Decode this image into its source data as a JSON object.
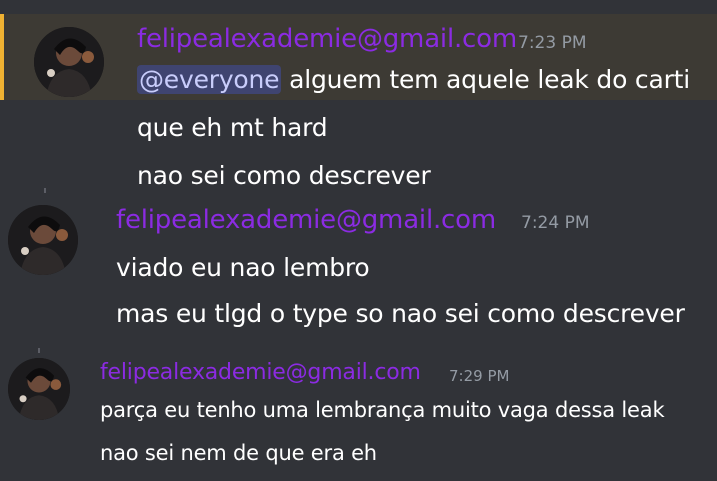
{
  "colors": {
    "background": "#313338",
    "mention_highlight": "#3d3a34",
    "mention_border": "#f0b232",
    "author": "#8b2be2",
    "timestamp": "#949ba4",
    "text": "#ffffff",
    "mention_tag_bg": "#3f4470",
    "mention_tag_text": "#c9cdfb"
  },
  "messages": [
    {
      "author": "felipealexademie@gmail.com",
      "time": "7:23 PM",
      "avatar_icon": "user-avatar-icon",
      "mention": "@everyone",
      "lines": [
        "alguem tem aquele leak do carti",
        "que eh mt hard",
        "nao sei como descrever"
      ]
    },
    {
      "author": "felipealexademie@gmail.com",
      "time": "7:24 PM",
      "avatar_icon": "user-avatar-icon",
      "lines": [
        "viado eu nao lembro",
        "mas eu tlgd o type so nao sei como descrever"
      ]
    },
    {
      "author": "felipealexademie@gmail.com",
      "time": "7:29 PM",
      "avatar_icon": "user-avatar-icon",
      "lines": [
        "parça eu tenho uma lembrança muito vaga dessa leak",
        "nao sei nem de que era eh"
      ]
    }
  ]
}
